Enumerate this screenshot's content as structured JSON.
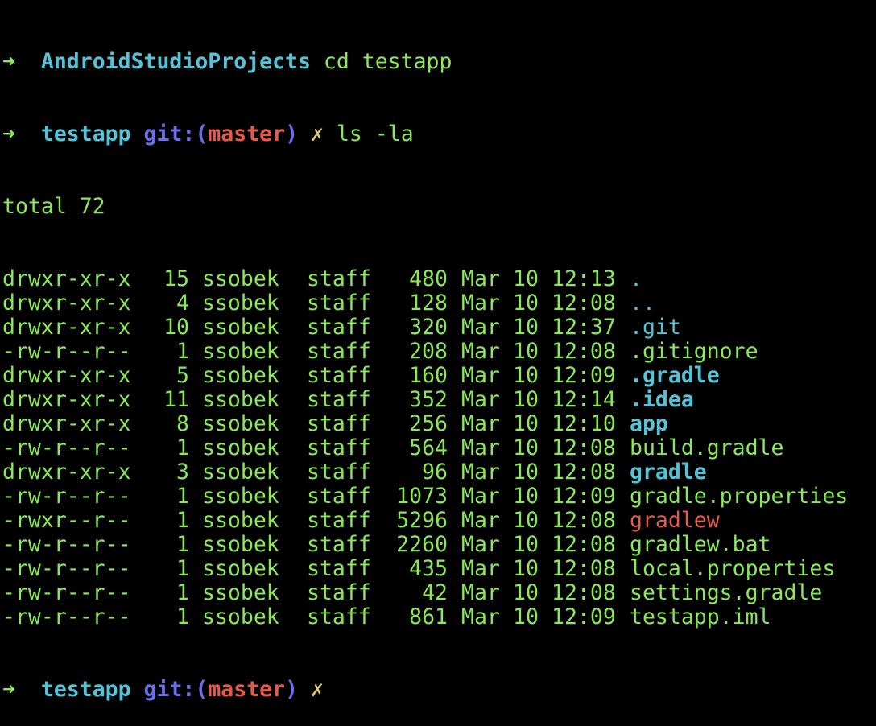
{
  "terminal": {
    "prompt1": {
      "arrow": "➜",
      "cwd": "AndroidStudioProjects",
      "command": "cd testapp"
    },
    "prompt2": {
      "arrow": "➜",
      "cwd": "testapp",
      "git_label": "git:",
      "open_paren": "(",
      "branch": "master",
      "close_paren": ")",
      "dirty_mark": "✗",
      "command": "ls -la"
    },
    "total_line": "total 72",
    "listing": [
      {
        "perm": "drwxr-xr-x",
        "links": "15",
        "user": "ssobek",
        "group": "staff",
        "size": "480",
        "month": "Mar",
        "day": "10",
        "time": "12:13",
        "name": ".",
        "kind": "dotdir"
      },
      {
        "perm": "drwxr-xr-x",
        "links": "4",
        "user": "ssobek",
        "group": "staff",
        "size": "128",
        "month": "Mar",
        "day": "10",
        "time": "12:08",
        "name": "..",
        "kind": "dotdir"
      },
      {
        "perm": "drwxr-xr-x",
        "links": "10",
        "user": "ssobek",
        "group": "staff",
        "size": "320",
        "month": "Mar",
        "day": "10",
        "time": "12:37",
        "name": ".git",
        "kind": "dotdir"
      },
      {
        "perm": "-rw-r--r--",
        "links": "1",
        "user": "ssobek",
        "group": "staff",
        "size": "208",
        "month": "Mar",
        "day": "10",
        "time": "12:08",
        "name": ".gitignore",
        "kind": "file"
      },
      {
        "perm": "drwxr-xr-x",
        "links": "5",
        "user": "ssobek",
        "group": "staff",
        "size": "160",
        "month": "Mar",
        "day": "10",
        "time": "12:09",
        "name": ".gradle",
        "kind": "dir"
      },
      {
        "perm": "drwxr-xr-x",
        "links": "11",
        "user": "ssobek",
        "group": "staff",
        "size": "352",
        "month": "Mar",
        "day": "10",
        "time": "12:14",
        "name": ".idea",
        "kind": "dir"
      },
      {
        "perm": "drwxr-xr-x",
        "links": "8",
        "user": "ssobek",
        "group": "staff",
        "size": "256",
        "month": "Mar",
        "day": "10",
        "time": "12:10",
        "name": "app",
        "kind": "dir"
      },
      {
        "perm": "-rw-r--r--",
        "links": "1",
        "user": "ssobek",
        "group": "staff",
        "size": "564",
        "month": "Mar",
        "day": "10",
        "time": "12:08",
        "name": "build.gradle",
        "kind": "file"
      },
      {
        "perm": "drwxr-xr-x",
        "links": "3",
        "user": "ssobek",
        "group": "staff",
        "size": "96",
        "month": "Mar",
        "day": "10",
        "time": "12:08",
        "name": "gradle",
        "kind": "dir"
      },
      {
        "perm": "-rw-r--r--",
        "links": "1",
        "user": "ssobek",
        "group": "staff",
        "size": "1073",
        "month": "Mar",
        "day": "10",
        "time": "12:09",
        "name": "gradle.properties",
        "kind": "file"
      },
      {
        "perm": "-rwxr--r--",
        "links": "1",
        "user": "ssobek",
        "group": "staff",
        "size": "5296",
        "month": "Mar",
        "day": "10",
        "time": "12:08",
        "name": "gradlew",
        "kind": "exec"
      },
      {
        "perm": "-rw-r--r--",
        "links": "1",
        "user": "ssobek",
        "group": "staff",
        "size": "2260",
        "month": "Mar",
        "day": "10",
        "time": "12:08",
        "name": "gradlew.bat",
        "kind": "file"
      },
      {
        "perm": "-rw-r--r--",
        "links": "1",
        "user": "ssobek",
        "group": "staff",
        "size": "435",
        "month": "Mar",
        "day": "10",
        "time": "12:08",
        "name": "local.properties",
        "kind": "file"
      },
      {
        "perm": "-rw-r--r--",
        "links": "1",
        "user": "ssobek",
        "group": "staff",
        "size": "42",
        "month": "Mar",
        "day": "10",
        "time": "12:08",
        "name": "settings.gradle",
        "kind": "file"
      },
      {
        "perm": "-rw-r--r--",
        "links": "1",
        "user": "ssobek",
        "group": "staff",
        "size": "861",
        "month": "Mar",
        "day": "10",
        "time": "12:09",
        "name": "testapp.iml",
        "kind": "file"
      }
    ],
    "prompt3": {
      "arrow": "➜",
      "cwd": "testapp",
      "git_label": "git:",
      "open_paren": "(",
      "branch": "master",
      "close_paren": ")",
      "dirty_mark": "✗"
    }
  },
  "colors": {
    "background": "#000000",
    "foreground": "#8ae85a",
    "directory": "#56c2d6",
    "git_label": "#6b6ee8",
    "branch": "#e45b4a",
    "executable": "#e45b4a",
    "dirty_mark": "#d9c769"
  }
}
